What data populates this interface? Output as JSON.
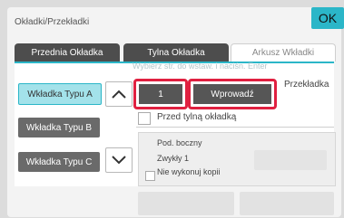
{
  "window": {
    "title": "Okładki/Przekładki",
    "ok_label": "OK"
  },
  "tabs": [
    {
      "label": "Przednia Okładka"
    },
    {
      "label": "Tylna Okładka"
    },
    {
      "label": "Arkusz Wkładki"
    }
  ],
  "hint": "Wybierz str. do wstaw. i naciśn. Enter",
  "insert_types": [
    {
      "label": "Wkładka Typu A",
      "selected": true
    },
    {
      "label": "Wkładka Typu B"
    },
    {
      "label": "Wkładka Typu C"
    }
  ],
  "page_number": {
    "value": "1"
  },
  "enter_label": "Wprowadź",
  "insert_label": "Przekładka",
  "checkbox": {
    "label": "Przed tylną okładką",
    "checked": false
  },
  "info": {
    "tray": "Pod. boczny",
    "paper": "Zwykły 1",
    "no_copy": "Nie wykonuj kopii"
  },
  "colors": {
    "accent": "#2bb6c8",
    "highlight": "#e02040"
  },
  "icons": {
    "up": "chevron-up-icon",
    "down": "chevron-down-icon"
  }
}
